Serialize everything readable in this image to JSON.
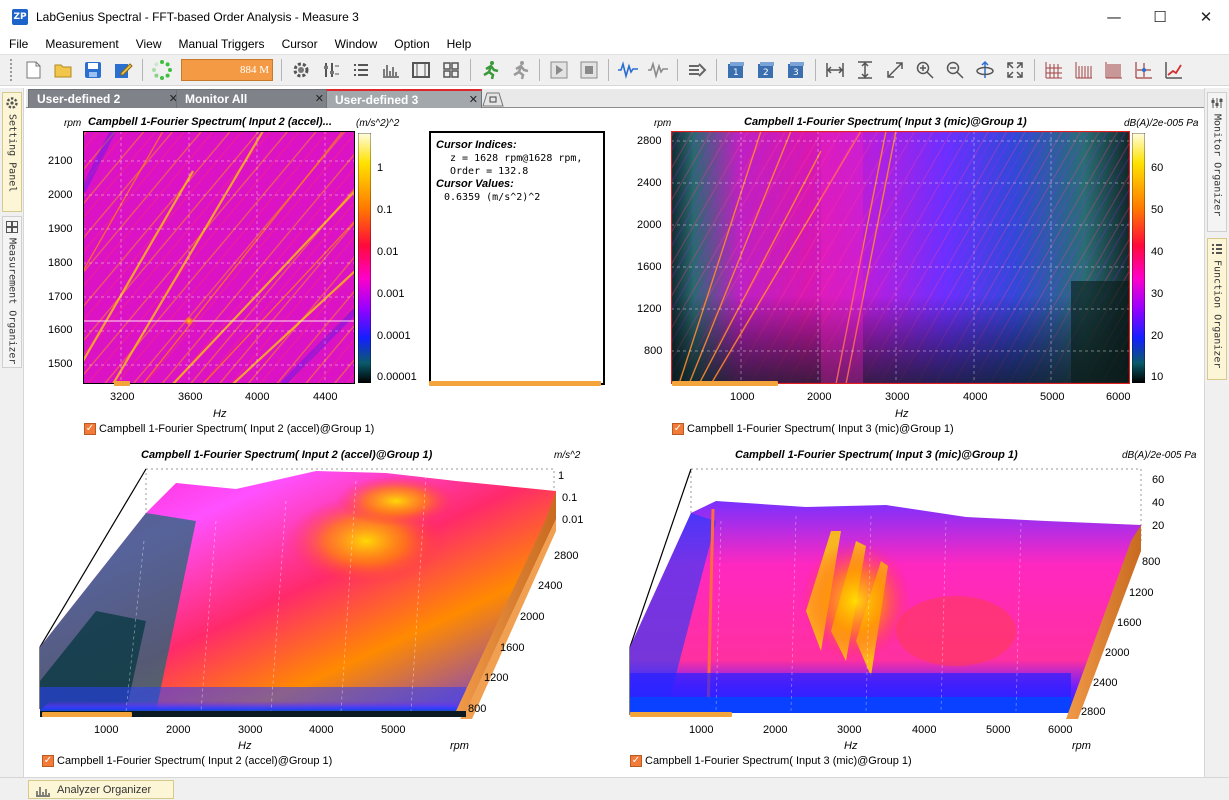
{
  "window": {
    "icon_text": "ZP",
    "title": "LabGenius Spectral - FFT-based Order Analysis - Measure 3",
    "min": "—",
    "max": "☐",
    "close": "✕"
  },
  "menu": [
    "File",
    "Measurement",
    "View",
    "Manual Triggers",
    "Cursor",
    "Window",
    "Option",
    "Help"
  ],
  "toolbar": {
    "memory": "884 M"
  },
  "side_panels": {
    "left": [
      "Setting Panel",
      "Measurement Organizer"
    ],
    "right": [
      "Monitor Organizer",
      "Function Organizer"
    ]
  },
  "tabs": [
    {
      "label": "User-defined 2",
      "active": false
    },
    {
      "label": "Monitor All",
      "active": false
    },
    {
      "label": "User-defined 3",
      "active": true
    }
  ],
  "plots": {
    "tl": {
      "title": "Campbell 1-Fourier Spectrum( Input 2 (accel)...",
      "y_unit": "rpm",
      "z_unit": "(m/s^2)^2",
      "y_ticks": [
        "2100",
        "2000",
        "1900",
        "1800",
        "1700",
        "1600",
        "1500"
      ],
      "x_ticks": [
        "3200",
        "3600",
        "4000",
        "4400"
      ],
      "x_label": "Hz",
      "cb_ticks": [
        "1",
        "0.1",
        "0.01",
        "0.001",
        "0.0001",
        "0.00001"
      ],
      "legend": "Campbell 1-Fourier Spectrum( Input 2 (accel)@Group 1)"
    },
    "tr": {
      "title": "Campbell 1-Fourier Spectrum( Input 3 (mic)@Group 1)",
      "y_unit": "rpm",
      "z_unit": "dB(A)/2e-005 Pa",
      "y_ticks": [
        "2800",
        "2400",
        "2000",
        "1600",
        "1200",
        "800"
      ],
      "x_ticks": [
        "1000",
        "2000",
        "3000",
        "4000",
        "5000",
        "6000"
      ],
      "x_label": "Hz",
      "cb_ticks": [
        "60",
        "50",
        "40",
        "30",
        "20",
        "10"
      ],
      "legend": "Campbell 1-Fourier Spectrum( Input 3 (mic)@Group 1)"
    },
    "bl": {
      "title": "Campbell 1-Fourier Spectrum( Input 2 (accel)@Group 1)",
      "z_unit": "m/s^2",
      "z_ticks": [
        "1",
        "0.1",
        "0.01"
      ],
      "rpm_ticks": [
        "2800",
        "2400",
        "2000",
        "1600",
        "1200",
        "800"
      ],
      "x_ticks": [
        "1000",
        "2000",
        "3000",
        "4000",
        "5000"
      ],
      "x_label": "Hz",
      "rpm_label": "rpm",
      "legend": "Campbell 1-Fourier Spectrum( Input 2 (accel)@Group 1)"
    },
    "br": {
      "title": "Campbell 1-Fourier Spectrum( Input 3 (mic)@Group 1)",
      "z_unit": "dB(A)/2e-005 Pa",
      "z_ticks": [
        "60",
        "40",
        "20"
      ],
      "rpm_ticks": [
        "800",
        "1200",
        "1600",
        "2000",
        "2400",
        "2800"
      ],
      "x_ticks": [
        "1000",
        "2000",
        "3000",
        "4000",
        "5000",
        "6000"
      ],
      "x_label": "Hz",
      "rpm_label": "rpm",
      "legend": "Campbell 1-Fourier Spectrum( Input 3 (mic)@Group 1)"
    }
  },
  "cursor": {
    "indices_title": "Cursor Indices:",
    "z_line": "z = 1628 rpm@1628 rpm,",
    "order_line": "Order = 132.8",
    "values_title": "Cursor Values:",
    "value_line": "0.6359 (m/s^2)^2"
  },
  "statusbar": {
    "tab": "Analyzer Organizer"
  }
}
